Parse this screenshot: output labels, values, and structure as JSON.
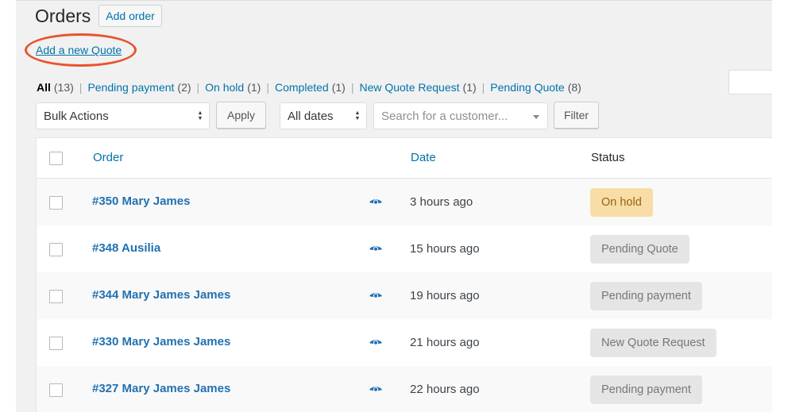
{
  "header": {
    "title": "Orders",
    "add_order_label": "Add order",
    "add_quote_link": "Add a new Quote"
  },
  "status_filters": [
    {
      "label": "All",
      "count": "(13)",
      "current": true
    },
    {
      "label": "Pending payment",
      "count": "(2)"
    },
    {
      "label": "On hold",
      "count": "(1)"
    },
    {
      "label": "Completed",
      "count": "(1)"
    },
    {
      "label": "New Quote Request",
      "count": "(1)"
    },
    {
      "label": "Pending Quote",
      "count": "(8)"
    }
  ],
  "toolbar": {
    "bulk_actions": "Bulk Actions",
    "apply_label": "Apply",
    "date_filter": "All dates",
    "customer_search_placeholder": "Search for a customer...",
    "filter_label": "Filter"
  },
  "table": {
    "columns": {
      "order": "Order",
      "date": "Date",
      "status": "Status"
    },
    "rows": [
      {
        "order": "#350 Mary James",
        "date": "3 hours ago",
        "status": "On hold",
        "status_key": "on-hold"
      },
      {
        "order": "#348 Ausilia",
        "date": "15 hours ago",
        "status": "Pending Quote",
        "status_key": "pending-quote"
      },
      {
        "order": "#344 Mary James James",
        "date": "19 hours ago",
        "status": "Pending payment",
        "status_key": "pending-payment"
      },
      {
        "order": "#330 Mary James James",
        "date": "21 hours ago",
        "status": "New Quote Request",
        "status_key": "new-quote-request"
      },
      {
        "order": "#327 Mary James James",
        "date": "22 hours ago",
        "status": "Pending payment",
        "status_key": "pending-payment"
      }
    ]
  },
  "colors": {
    "link": "#0073aa",
    "highlight": "#e8542f",
    "on_hold_bg": "#f8dda7",
    "on_hold_text": "#94660c",
    "status_bg": "#e5e5e5"
  },
  "icons": {
    "preview": "eye-icon",
    "select_arrows": "up-down-arrows-icon",
    "dropdown": "chevron-down-icon"
  }
}
